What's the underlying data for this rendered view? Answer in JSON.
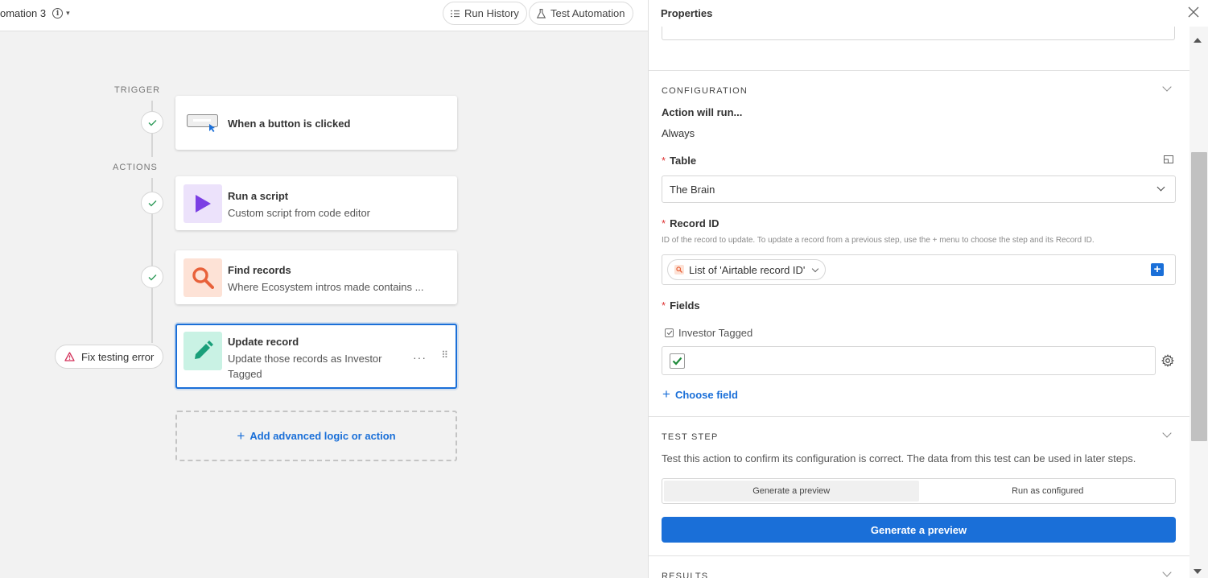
{
  "topbar": {
    "automation_name": "omation 3",
    "run_history_label": "Run History",
    "test_automation_label": "Test Automation"
  },
  "canvas": {
    "trigger_label": "TRIGGER",
    "actions_label": "ACTIONS",
    "trigger_card": {
      "title": "When a button is clicked"
    },
    "steps": [
      {
        "title": "Run a script",
        "subtitle": "Custom script from code editor"
      },
      {
        "title": "Find records",
        "subtitle": "Where Ecosystem intros made contains ..."
      },
      {
        "title": "Update record",
        "subtitle_line1": "Update those records as Investor",
        "subtitle_line2": "Tagged"
      }
    ],
    "fix_error_label": "Fix testing error",
    "add_action_label": "Add advanced logic or action",
    "more_glyph": "···",
    "drag_glyph": "⠿"
  },
  "panel": {
    "title": "Properties",
    "configuration": {
      "heading": "CONFIGURATION",
      "action_will_run_label": "Action will run...",
      "action_will_run_value": "Always",
      "table_label": "Table",
      "table_value": "The Brain",
      "record_id_label": "Record ID",
      "record_id_hint": "ID of the record to update. To update a record from a previous step, use the + menu to choose the step and its Record ID.",
      "record_id_token": "List of 'Airtable record ID'",
      "fields_label": "Fields",
      "field_name": "Investor Tagged",
      "field_checked": true,
      "choose_field_label": "Choose field",
      "required_mark": "*"
    },
    "test_step": {
      "heading": "TEST STEP",
      "description": "Test this action to confirm its configuration is correct. The data from this test can be used in later steps.",
      "options": [
        "Generate a preview",
        "Run as configured"
      ],
      "active_option": 0,
      "primary_button": "Generate a preview"
    },
    "results": {
      "heading": "RESULTS"
    }
  },
  "colors": {
    "accent": "#1a6fd8",
    "script_icon_bg": "#ece2fb",
    "script_icon": "#7b3fe4",
    "find_icon_bg": "#fde2d6",
    "find_icon": "#e8613a",
    "update_icon_bg": "#c9f2e4",
    "update_icon": "#1a9f7a",
    "error": "#d3325a"
  }
}
